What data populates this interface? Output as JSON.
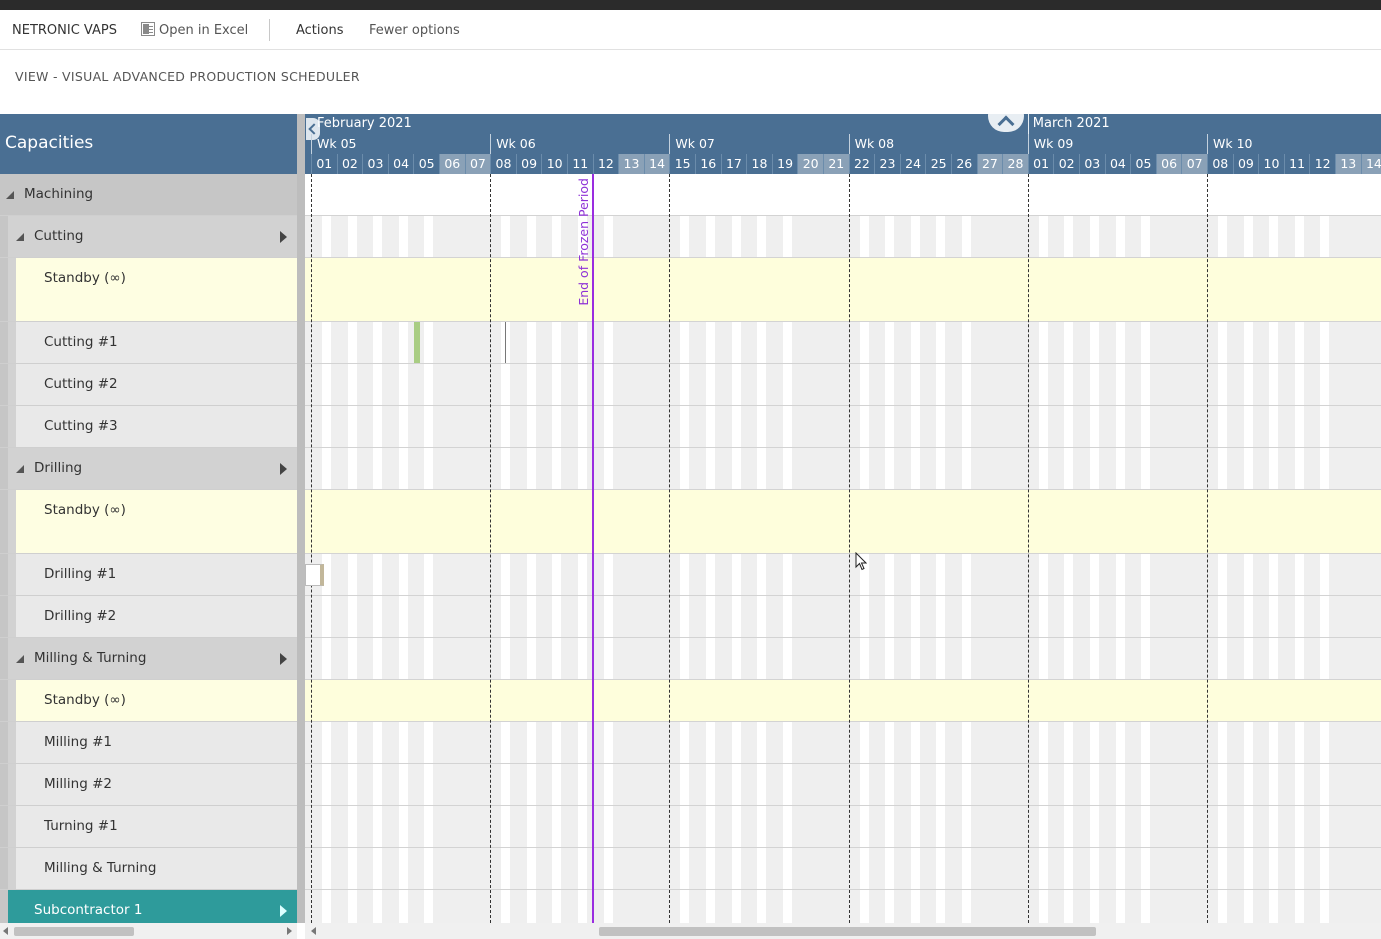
{
  "app": {
    "name": "NETRONIC VAPS",
    "open_excel": "Open in Excel",
    "actions": "Actions",
    "fewer_options": "Fewer options",
    "view_title": "VIEW - VISUAL ADVANCED PRODUCTION SCHEDULER"
  },
  "capacities_header": "Capacities",
  "rows": [
    {
      "label": "Machining",
      "kind": "group0"
    },
    {
      "label": "Cutting",
      "kind": "group1"
    },
    {
      "label": "Standby (∞)",
      "kind": "standby",
      "tall": true
    },
    {
      "label": "Cutting #1",
      "kind": "res"
    },
    {
      "label": "Cutting #2",
      "kind": "res"
    },
    {
      "label": "Cutting #3",
      "kind": "res"
    },
    {
      "label": "Drilling",
      "kind": "group1"
    },
    {
      "label": "Standby (∞)",
      "kind": "standby",
      "tall": true
    },
    {
      "label": "Drilling #1",
      "kind": "res"
    },
    {
      "label": "Drilling #2",
      "kind": "res"
    },
    {
      "label": "Milling & Turning",
      "kind": "group1"
    },
    {
      "label": "Standby (∞)",
      "kind": "standby"
    },
    {
      "label": "Milling #1",
      "kind": "res"
    },
    {
      "label": "Milling #2",
      "kind": "res"
    },
    {
      "label": "Turning #1",
      "kind": "res"
    },
    {
      "label": "Milling & Turning",
      "kind": "res"
    },
    {
      "label": "Subcontractor 1",
      "kind": "sub"
    }
  ],
  "timeline": {
    "months": [
      "February 2021",
      "March 2021"
    ],
    "weeks": [
      "Wk 05",
      "Wk 06",
      "Wk 07",
      "Wk 08",
      "Wk 09",
      "Wk 10"
    ],
    "days": [
      "01",
      "02",
      "03",
      "04",
      "05",
      "06",
      "07",
      "08",
      "09",
      "10",
      "11",
      "12",
      "13",
      "14",
      "15",
      "16",
      "17",
      "18",
      "19",
      "20",
      "21",
      "22",
      "23",
      "24",
      "25",
      "26",
      "27",
      "28",
      "01",
      "02",
      "03",
      "04",
      "05",
      "06",
      "07",
      "08",
      "09",
      "10",
      "11",
      "12",
      "13",
      "14"
    ],
    "weekend_days": [
      5,
      6,
      12,
      13,
      19,
      20,
      26,
      27,
      33,
      34,
      40,
      41
    ],
    "frozen_label": "End of Frozen Period",
    "frozen_day_index": 10
  },
  "colors": {
    "header_blue": "#4a6f93",
    "standby_yellow": "#fefedc",
    "frozen_purple": "#9a2de0",
    "subcontractor_teal": "#2e9b9b",
    "bar_green": "#a9cd83"
  }
}
